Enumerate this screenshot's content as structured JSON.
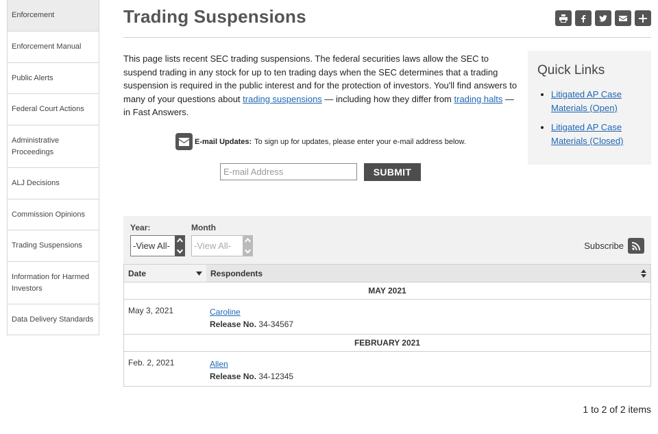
{
  "sidebar": {
    "items": [
      {
        "label": "Enforcement"
      },
      {
        "label": "Enforcement Manual"
      },
      {
        "label": "Public Alerts"
      },
      {
        "label": "Federal Court Actions"
      },
      {
        "label": "Administrative Proceedings"
      },
      {
        "label": "ALJ Decisions"
      },
      {
        "label": "Commission Opinions"
      },
      {
        "label": "Trading Suspensions"
      },
      {
        "label": "Information for Harmed Investors"
      },
      {
        "label": "Data Delivery Standards"
      }
    ]
  },
  "page": {
    "title": "Trading Suspensions"
  },
  "share": [
    "print-icon",
    "facebook-icon",
    "twitter-icon",
    "email-icon",
    "plus-icon"
  ],
  "intro": {
    "text1": "This page lists recent SEC trading suspensions. The federal securities laws allow the SEC to suspend trading in any stock for up to ten trading days when the SEC determines that a trading suspension is required in the public interest and for the protection of investors. You'll find answers to many of your questions about ",
    "link1": "trading suspensions",
    "text2": " — including how they differ from ",
    "link2": "trading halts",
    "text3": " — in Fast Answers."
  },
  "quick_links": {
    "title": "Quick Links",
    "items": [
      "Litigated AP Case Materials (Open)",
      "Litigated AP Case Materials (Closed)"
    ]
  },
  "email": {
    "label": "E-mail Updates:",
    "text": "To sign up for updates, please enter your e-mail address below.",
    "placeholder": "E-mail Address",
    "submit": "SUBMIT"
  },
  "filters": {
    "year_label": "Year:",
    "year_value": "-View All-",
    "month_label": "Month",
    "month_value": "-View All-",
    "subscribe": "Subscribe"
  },
  "table": {
    "headers": {
      "date": "Date",
      "respondents": "Respondents"
    },
    "groups": [
      {
        "title": "MAY 2021",
        "rows": [
          {
            "date": "May 3, 2021",
            "name": "Caroline",
            "release_label": "Release No.",
            "release": "34-34567"
          }
        ]
      },
      {
        "title": "FEBRUARY 2021",
        "rows": [
          {
            "date": "Feb. 2, 2021",
            "name": "Allen",
            "release_label": "Release No.",
            "release": "34-12345"
          }
        ]
      }
    ]
  },
  "pager": {
    "text": "1 to 2 of 2 items"
  }
}
